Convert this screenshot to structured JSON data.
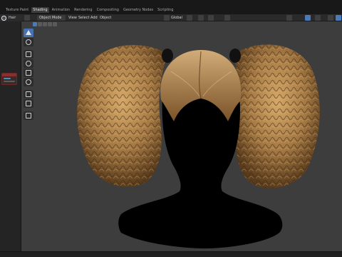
{
  "workspace_tabs": [
    "Texture Paint",
    "Shading",
    "Animation",
    "Rendering",
    "Compositing",
    "Geometry Nodes",
    "Scripting"
  ],
  "active_tab": "Shading",
  "left_panel": {
    "title": "Hair"
  },
  "viewport_header": {
    "mode": "Object Mode",
    "menu": [
      "View",
      "Select",
      "Add",
      "Object"
    ],
    "transform_orientation": "Global"
  },
  "colors": {
    "accent": "#4a7ab8",
    "viewport_bg": "#3d3d3d",
    "hair": "#a67a44"
  },
  "icons": {
    "tools": [
      "cursor-icon",
      "select-circle-icon",
      "move-icon",
      "rotate-icon",
      "scale-icon",
      "transform-icon",
      "annotate-icon",
      "measure-icon",
      "add-cube-icon"
    ]
  }
}
